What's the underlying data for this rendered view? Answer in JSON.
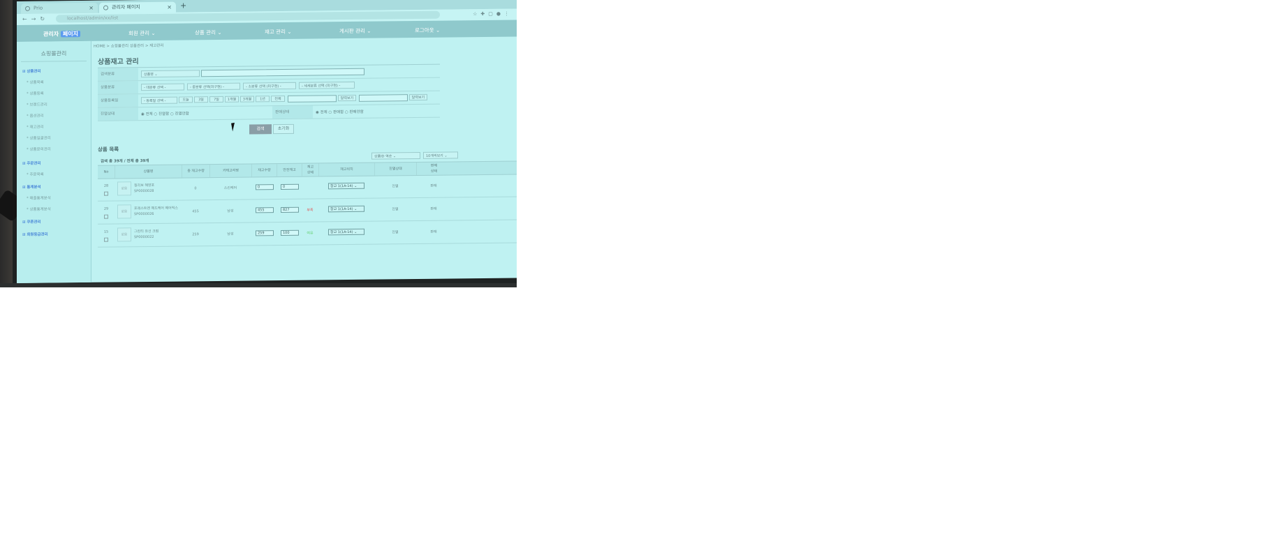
{
  "browser": {
    "tabs": [
      {
        "label": "Prio",
        "active": false
      },
      {
        "label": "관리자 페이지",
        "active": true
      }
    ],
    "url": "localhost/admin/xx/list"
  },
  "header": {
    "brand": "관리자",
    "brand_accent": "페이지",
    "menus": [
      "회원 관리",
      "상품 관리",
      "재고 관리",
      "게시판 관리",
      "로그아웃"
    ]
  },
  "sidebar": {
    "title": "쇼핑몰관리",
    "items": [
      {
        "label": "상품관리",
        "type": "head"
      },
      {
        "label": "상품목록",
        "type": "sub"
      },
      {
        "label": "상품등록",
        "type": "sub"
      },
      {
        "label": "브랜드관리",
        "type": "sub"
      },
      {
        "label": "옵션관리",
        "type": "sub"
      },
      {
        "label": "재고관리",
        "type": "sub"
      },
      {
        "label": "상품일괄관리",
        "type": "sub"
      },
      {
        "label": "상품문의관리",
        "type": "sub"
      },
      {
        "label": "주문관리",
        "type": "head"
      },
      {
        "label": "주문목록",
        "type": "sub"
      },
      {
        "label": "통계분석",
        "type": "head"
      },
      {
        "label": "매출통계분석",
        "type": "sub"
      },
      {
        "label": "상품통계분석",
        "type": "sub"
      },
      {
        "label": "쿠폰관리",
        "type": "head"
      },
      {
        "label": "회원등급관리",
        "type": "head"
      }
    ]
  },
  "breadcrumb": "HOME > 쇼핑몰관리 상품관리 > 재고관리",
  "page_title": "상품재고 관리",
  "search_form": {
    "keyword_label": "검색분류",
    "keyword_select": "상품명",
    "category_label": "상품분류",
    "category_selects": [
      "- 대분류 선택 -",
      "- 중분류 선택(미구현) -",
      "- 소분류 선택 (미구현) -",
      "- 세세분류 선택 (미구현) -"
    ],
    "period_label": "상품등록일",
    "period_select": "- 등록일 선택 -",
    "period_buttons": [
      "오늘",
      "3일",
      "7일",
      "1개월",
      "3개월",
      "1년",
      "전체"
    ],
    "date_button": "달력보기",
    "sale_status_label": "진열상태",
    "sale_status_options": [
      "전체",
      "진열함",
      "진열안함"
    ],
    "sell_status_label": "판매상태",
    "sell_status_options": [
      "전체",
      "판매함",
      "판매안함"
    ],
    "search_button": "검색",
    "reset_button": "초기화"
  },
  "list": {
    "title": "상품 목록",
    "summary": "검색 총 39개 / 전체 총 39개",
    "sort_select": "상품ID 역순",
    "page_size_select": "10개씩보기",
    "columns": [
      "No",
      "상품명",
      "총 재고수량",
      "카테고리명",
      "재고수량",
      "안전재고",
      "재고\n상태",
      "재고위치",
      "진열상태",
      "판매\n상태"
    ],
    "rows": [
      {
        "no": "28",
        "thumb": "없음",
        "name": "칠리보 해양포",
        "code": "SP0000028",
        "total_stock": "0",
        "category": "스킨케어",
        "stock": "0",
        "safety": "0",
        "status": "",
        "location": "창고 1(1A-14)",
        "display": "진열",
        "sell": "판매"
      },
      {
        "no": "29",
        "thumb": "없음",
        "name": "포레스트엔 헤드케어 헤어픽스",
        "code": "SP0000026",
        "total_stock": "455",
        "category": "남성",
        "stock": "455",
        "safety": "827",
        "status": "부족",
        "location": "창고 1(1A-14)",
        "display": "진열",
        "sell": "판매"
      },
      {
        "no": "15",
        "thumb": "없음",
        "name": "그린티 유선 크림",
        "code": "SP0000022",
        "total_stock": "259",
        "category": "남성",
        "stock": "259",
        "safety": "100",
        "status": "여유",
        "location": "창고 1(1A-14)",
        "display": "진열",
        "sell": "판매"
      }
    ]
  },
  "colors": {
    "screen_tint": "#bff2f2",
    "nav_bar": "#8fc9cc",
    "accent_blue": "#4a87d8",
    "status_low": "#e05a5a",
    "status_ok": "#5fcf6a"
  }
}
